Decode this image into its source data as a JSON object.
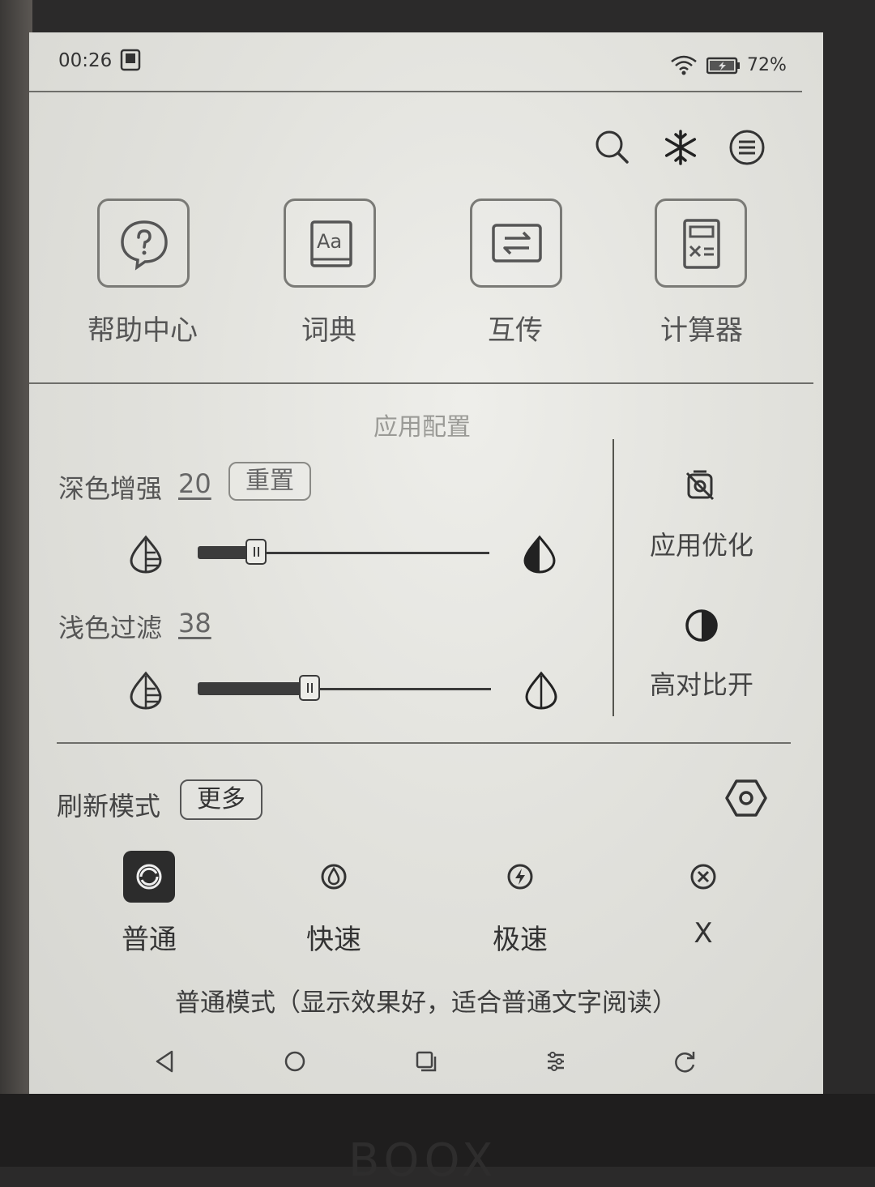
{
  "status_bar": {
    "time": "00:26",
    "battery": "72%"
  },
  "top_actions": {
    "icons": [
      "search-icon",
      "freeze-snowflake-icon",
      "menu-icon"
    ]
  },
  "apps": [
    {
      "label": "帮助中心",
      "icon": "help-bubble-icon"
    },
    {
      "label": "词典",
      "icon": "dictionary-icon"
    },
    {
      "label": "互传",
      "icon": "transfer-icon"
    },
    {
      "label": "计算器",
      "icon": "calculator-icon"
    }
  ],
  "app_config": {
    "title": "应用配置",
    "dark_enhance": {
      "label": "深色增强",
      "value": "20",
      "reset_label": "重置",
      "level": 0.2
    },
    "light_filter": {
      "label": "浅色过滤",
      "value": "38",
      "level": 0.38
    },
    "app_optimize_label": "应用优化",
    "high_contrast_label": "高对比开"
  },
  "refresh": {
    "title": "刷新模式",
    "more_label": "更多",
    "modes": [
      {
        "label": "普通",
        "active": true
      },
      {
        "label": "快速",
        "active": false
      },
      {
        "label": "极速",
        "active": false
      },
      {
        "label": "X",
        "active": false
      }
    ],
    "description": "普通模式（显示效果好，适合普通文字阅读）"
  },
  "navbar": {
    "icons": [
      "back-icon",
      "home-icon",
      "recent-apps-icon",
      "adjust-icon",
      "refresh-icon"
    ]
  },
  "device": {
    "brand": "BOOX"
  },
  "colors": {
    "screen": "#deded9",
    "ink": "#2a2a2a",
    "active_mode_bg": "#2c2c2c"
  }
}
